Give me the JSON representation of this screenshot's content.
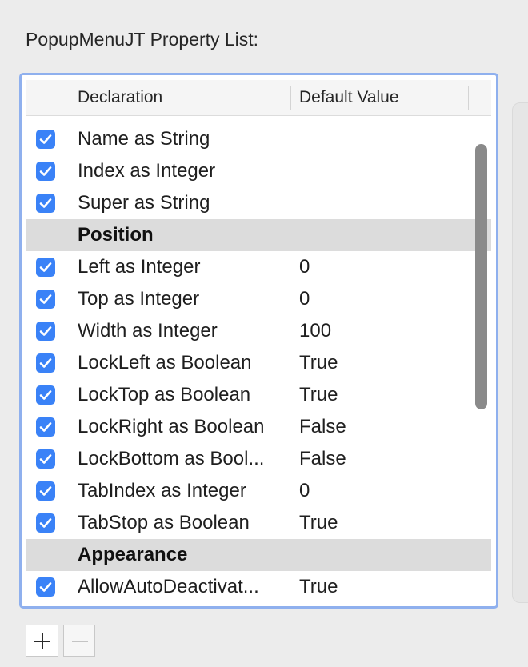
{
  "panel_title": "PopupMenuJT Property List:",
  "columns": {
    "declaration": "Declaration",
    "default_value": "Default Value"
  },
  "rows": [
    {
      "type": "item",
      "checked": true,
      "declaration": "Name as String",
      "value": ""
    },
    {
      "type": "item",
      "checked": true,
      "declaration": "Index as Integer",
      "value": ""
    },
    {
      "type": "item",
      "checked": true,
      "declaration": "Super as String",
      "value": ""
    },
    {
      "type": "group",
      "declaration": "Position"
    },
    {
      "type": "item",
      "checked": true,
      "declaration": "Left as Integer",
      "value": "0"
    },
    {
      "type": "item",
      "checked": true,
      "declaration": "Top as Integer",
      "value": "0"
    },
    {
      "type": "item",
      "checked": true,
      "declaration": "Width as Integer",
      "value": "100"
    },
    {
      "type": "item",
      "checked": true,
      "declaration": "LockLeft as Boolean",
      "value": "True"
    },
    {
      "type": "item",
      "checked": true,
      "declaration": "LockTop as Boolean",
      "value": "True"
    },
    {
      "type": "item",
      "checked": true,
      "declaration": "LockRight as Boolean",
      "value": "False"
    },
    {
      "type": "item",
      "checked": true,
      "declaration": "LockBottom as Bool...",
      "value": "False"
    },
    {
      "type": "item",
      "checked": true,
      "declaration": "TabIndex as Integer",
      "value": "0"
    },
    {
      "type": "item",
      "checked": true,
      "declaration": "TabStop as Boolean",
      "value": "True"
    },
    {
      "type": "group",
      "declaration": "Appearance"
    },
    {
      "type": "item",
      "checked": true,
      "declaration": "AllowAutoDeactivat...",
      "value": "True"
    }
  ],
  "buttons": {
    "add_icon": "plus-icon",
    "remove_icon": "minus-icon"
  },
  "colors": {
    "accent": "#3a82f7",
    "focus_ring": "#8fb0ee",
    "group_row": "#dcdcdc"
  }
}
